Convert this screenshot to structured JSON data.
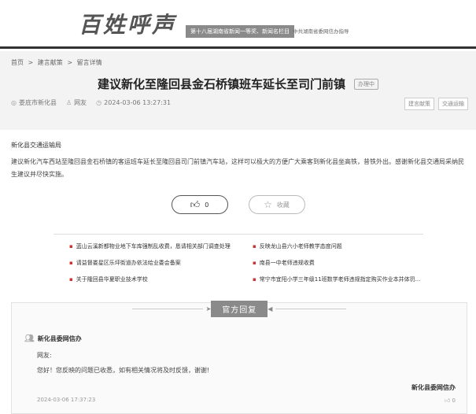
{
  "header": {
    "logo_text": "百姓呼声",
    "badge": "第十八届湖南省新闻一等奖、新闻名栏目",
    "sub": "中共湖南省委网信办指导"
  },
  "breadcrumb": {
    "home": "首页",
    "sep": ">",
    "section": "建言献策",
    "current": "留言详情"
  },
  "post": {
    "title": "建议新化至隆回县金石桥镇班车延长至司门前镇",
    "status": "办理中",
    "location": "娄底市新化县",
    "author": "网友",
    "time": "2024-03-06 13:27:31",
    "tags": [
      "建言献策",
      "交通运输"
    ],
    "recipient": "新化县交通运输局",
    "content": "建议新化汽车西站至隆回县金石桥镇的客运班车延长至隆回县司门前镇汽车站，这样可以极大的方便广大乘客到新化县坐高铁，昔铁外出。感谢新化县交通局采纳民生建议并尽快实施。",
    "like_count": "0",
    "favorite_label": "收藏"
  },
  "related": [
    "蓝山云溪新都物业地下车库强制乱收费，恳请相关部门调查处理",
    "反映龙山县六小老师教学态度问题",
    "请益督娄星区乐坪街道办依法给业委会备案",
    "南县一中老师违规收费",
    "关于隆回县华夏职业技术学校",
    "常宁市宜阳小学三年级11班数学老师违规指定购买作业本并体罚..."
  ],
  "reply": {
    "heading": "官方回复",
    "org": "新化县委网信办",
    "to": "网友:",
    "text": "您好！您反映的问题已收悉，如有相关情况将及时反馈，谢谢!",
    "sign": "新化县委网信办",
    "time": "2024-03-06 17:37:23",
    "likes": "0"
  },
  "colors": {
    "accent": "#8a8a8a",
    "bullet": "#cc3333"
  }
}
